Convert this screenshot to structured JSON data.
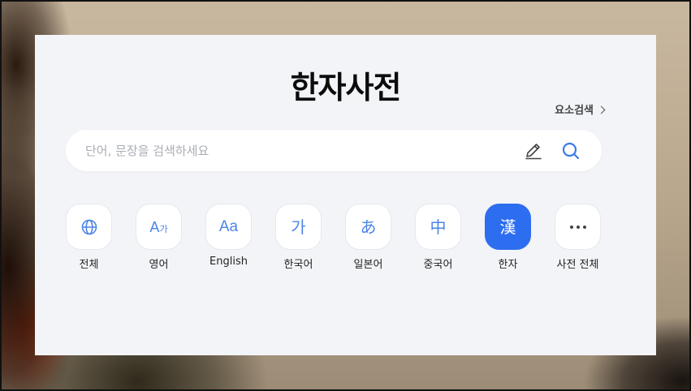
{
  "page": {
    "title": "한자사전",
    "advanced_search_label": "요소검색"
  },
  "search": {
    "value": "",
    "placeholder": "단어, 문장을 검색하세요",
    "icons": [
      "pen-icon",
      "search-icon"
    ]
  },
  "categories": [
    {
      "label": "전체",
      "icon": "globe-icon"
    },
    {
      "label": "영어",
      "icon": "english-korean-icon",
      "glyph": "A",
      "glyph_small": "가"
    },
    {
      "label": "English",
      "icon": "english-icon",
      "glyph": "Aa"
    },
    {
      "label": "한국어",
      "icon": "korean-icon",
      "glyph": "가"
    },
    {
      "label": "일본어",
      "icon": "japanese-icon",
      "glyph": "あ"
    },
    {
      "label": "중국어",
      "icon": "chinese-icon",
      "glyph": "中"
    },
    {
      "label": "한자",
      "icon": "hanja-icon",
      "glyph": "漢",
      "active": true
    },
    {
      "label": "사전 전체",
      "icon": "more-icon"
    }
  ],
  "colors": {
    "accent": "#2d6ef0",
    "icon_blue": "#4d84e8",
    "panel_bg": "#f3f4f7"
  }
}
